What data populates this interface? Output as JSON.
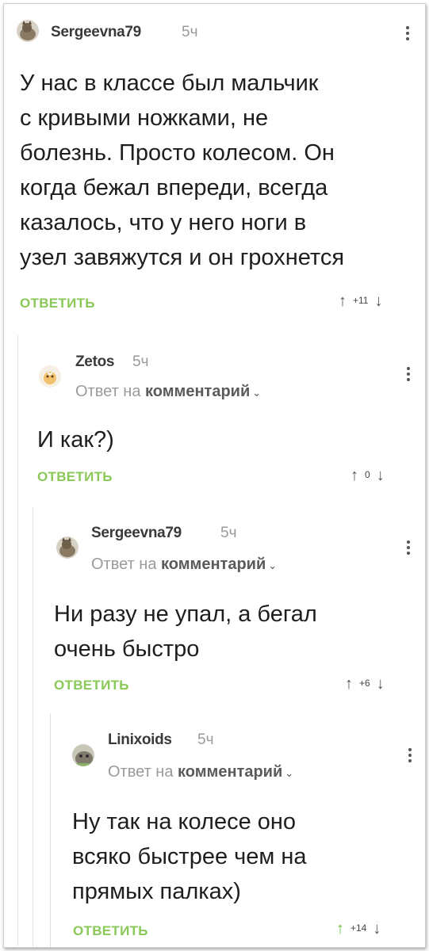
{
  "comments": [
    {
      "username": "Sergeevna79",
      "time": "5ч",
      "body_lines": [
        "У нас в классе был мальчик",
        "с кривыми ножками, не",
        "болезнь. Просто колесом. Он",
        "когда бежал впереди, всегда",
        "казалось, что у него ноги в",
        "узел завяжутся и он грохнется"
      ],
      "reply_label": "ОТВЕТИТЬ",
      "rating": "+11"
    },
    {
      "username": "Zetos",
      "time": "5ч",
      "reply_prefix": "Ответ на",
      "reply_link": "комментарий",
      "body_lines": [
        "И как?)"
      ],
      "reply_label": "ОТВЕТИТЬ",
      "rating": "0"
    },
    {
      "username": "Sergeevna79",
      "time": "5ч",
      "reply_prefix": "Ответ на",
      "reply_link": "комментарий",
      "body_lines": [
        "Ни разу не упал, а бегал",
        "очень быстро"
      ],
      "reply_label": "ОТВЕТИТЬ",
      "rating": "+6"
    },
    {
      "username": "Linixoids",
      "time": "5ч",
      "reply_prefix": "Ответ на",
      "reply_link": "комментарий",
      "body_lines": [
        "Ну так на колесе оно",
        "всяко быстрее чем на",
        "прямых палках)"
      ],
      "reply_label": "ОТВЕТИТЬ",
      "rating": "+14"
    }
  ],
  "colors": {
    "accent_green": "#8ac858",
    "upvote_active": "#6fbf3e",
    "muted_text": "#9a9a9a"
  },
  "icons": {
    "upvote": "arrow-up-icon",
    "downvote": "arrow-down-icon",
    "menu": "kebab-menu-icon",
    "chevron": "chevron-down-icon"
  }
}
